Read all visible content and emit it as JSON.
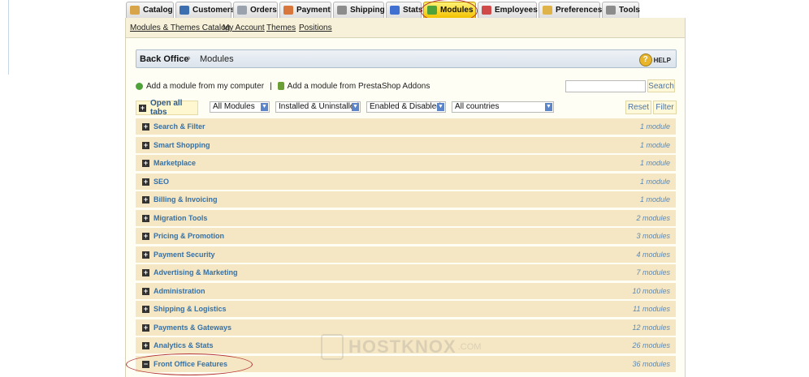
{
  "tabs": [
    {
      "label": "Catalog",
      "icon": "folder-icon",
      "color": "#d9a54a"
    },
    {
      "label": "Customers",
      "icon": "user-icon",
      "color": "#3b6fb0"
    },
    {
      "label": "Orders",
      "icon": "cart-icon",
      "color": "#9aa3ad"
    },
    {
      "label": "Payment",
      "icon": "payment-icon",
      "color": "#d9763b"
    },
    {
      "label": "Shipping",
      "icon": "truck-icon",
      "color": "#8c8c8c"
    },
    {
      "label": "Stats",
      "icon": "stats-icon",
      "color": "#3f6fd1"
    },
    {
      "label": "Modules",
      "icon": "puzzle-icon",
      "color": "#4fa23a",
      "active": true
    },
    {
      "label": "Employees",
      "icon": "employees-icon",
      "color": "#d04a4a"
    },
    {
      "label": "Preferences",
      "icon": "preferences-icon",
      "color": "#e0b24a"
    },
    {
      "label": "Tools",
      "icon": "wrench-icon",
      "color": "#8c8c8c"
    }
  ],
  "subnav": {
    "items": [
      "Modules & Themes Catalog",
      "My Account",
      "Themes",
      "Positions"
    ]
  },
  "breadcrumb": {
    "root": "Back Office",
    "separator": "›",
    "current": "Modules",
    "help_label": "HELP",
    "help_icon": "?"
  },
  "actions": {
    "add_from_computer": "Add a module from my computer",
    "divider": "|",
    "add_from_addons": "Add a module from PrestaShop Addons",
    "search_button": "Search",
    "search_value": ""
  },
  "filters": {
    "open_all": "Open all tabs",
    "expand_glyph": "+",
    "collapse_glyph": "−",
    "dropdown_glyph": "▼",
    "modules": "All Modules",
    "install_state": "Installed & Uninstalled",
    "enable_state": "Enabled & Disabled",
    "country": "All countries",
    "reset": "Reset",
    "filter": "Filter"
  },
  "categories": [
    {
      "name": "Search & Filter",
      "count": "1 module"
    },
    {
      "name": "Smart Shopping",
      "count": "1 module"
    },
    {
      "name": "Marketplace",
      "count": "1 module"
    },
    {
      "name": "SEO",
      "count": "1 module"
    },
    {
      "name": "Billing & Invoicing",
      "count": "1 module"
    },
    {
      "name": "Migration Tools",
      "count": "2 modules"
    },
    {
      "name": "Pricing & Promotion",
      "count": "3 modules"
    },
    {
      "name": "Payment Security",
      "count": "4 modules"
    },
    {
      "name": "Advertising & Marketing",
      "count": "7 modules"
    },
    {
      "name": "Administration",
      "count": "10 modules"
    },
    {
      "name": "Shipping & Logistics",
      "count": "11 modules"
    },
    {
      "name": "Payments & Gateways",
      "count": "12 modules"
    },
    {
      "name": "Analytics & Stats",
      "count": "26 modules"
    },
    {
      "name": "Front Office Features",
      "count": "36 modules",
      "expanded": true
    }
  ],
  "watermark": {
    "text": "HOSTKNOX",
    "suffix": ".COM"
  }
}
